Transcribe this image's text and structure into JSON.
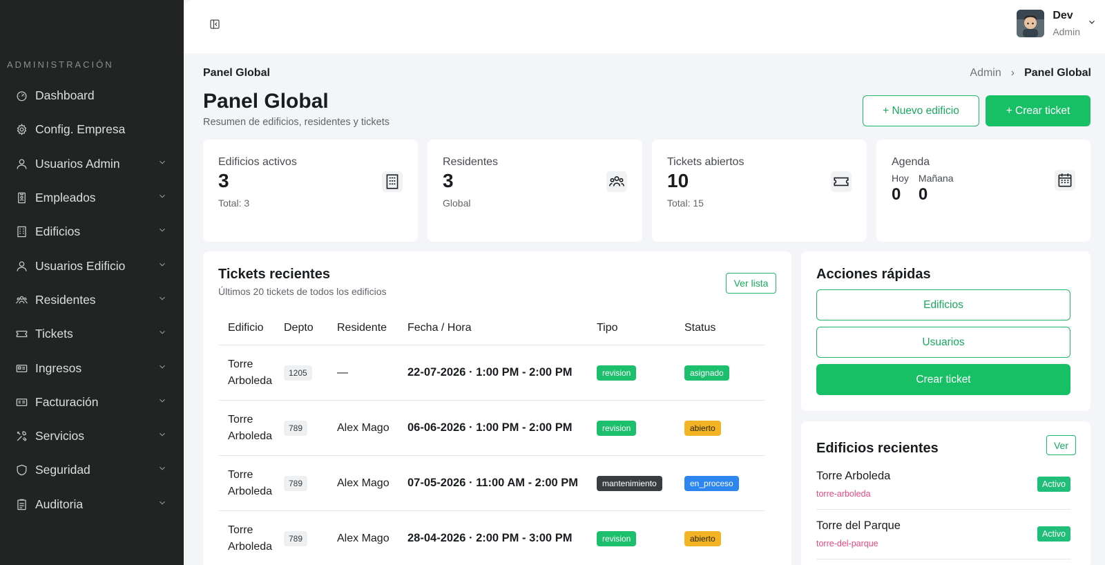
{
  "sidebar": {
    "section": "ADMINISTRACIÓN",
    "items": [
      {
        "label": "Dashboard",
        "icon": "dashboard-icon",
        "chevron": false
      },
      {
        "label": "Config. Empresa",
        "icon": "gear-icon",
        "chevron": false
      },
      {
        "label": "Usuarios Admin",
        "icon": "user-icon",
        "chevron": true
      },
      {
        "label": "Empleados",
        "icon": "badge-icon",
        "chevron": true
      },
      {
        "label": "Edificios",
        "icon": "building-icon",
        "chevron": true
      },
      {
        "label": "Usuarios Edificio",
        "icon": "user-icon",
        "chevron": true
      },
      {
        "label": "Residentes",
        "icon": "group-icon",
        "chevron": true
      },
      {
        "label": "Tickets",
        "icon": "ticket-icon",
        "chevron": true
      },
      {
        "label": "Ingresos",
        "icon": "id-card-icon",
        "chevron": true
      },
      {
        "label": "Facturación",
        "icon": "invoice-icon",
        "chevron": true
      },
      {
        "label": "Servicios",
        "icon": "tools-icon",
        "chevron": true
      },
      {
        "label": "Seguridad",
        "icon": "shield-icon",
        "chevron": true
      },
      {
        "label": "Auditoria",
        "icon": "clipboard-icon",
        "chevron": true
      }
    ]
  },
  "user": {
    "name": "Dev",
    "role": "Admin"
  },
  "breadcrumb": {
    "left": "Panel Global",
    "root": "Admin",
    "separator": "›",
    "current": "Panel Global"
  },
  "page": {
    "title": "Panel Global",
    "subtitle": "Resumen de edificios, residentes y tickets"
  },
  "actions": {
    "new_building": "+ Nuevo edificio",
    "create_ticket": "+ Crear ticket"
  },
  "stats": {
    "buildings": {
      "label": "Edificios activos",
      "value": "3",
      "sub": "Total: 3"
    },
    "residents": {
      "label": "Residentes",
      "value": "3",
      "sub": "Global"
    },
    "tickets": {
      "label": "Tickets abiertos",
      "value": "10",
      "sub": "Total: 15"
    },
    "agenda": {
      "label": "Agenda",
      "today_label": "Hoy",
      "today_value": "0",
      "tomorrow_label": "Mañana",
      "tomorrow_value": "0"
    }
  },
  "tickets": {
    "title": "Tickets recientes",
    "subtitle": "Últimos 20 tickets de todos los edificios",
    "view_list": "Ver lista",
    "columns": [
      "Edificio",
      "Depto",
      "Residente",
      "Fecha / Hora",
      "Tipo",
      "Status"
    ],
    "rows": [
      {
        "building": "Torre Arboleda",
        "depto": "1205",
        "resident": "—",
        "datetime": "22-07-2026 · 1:00 PM - 2:00 PM",
        "type": "revision",
        "status": "asignado"
      },
      {
        "building": "Torre Arboleda",
        "depto": "789",
        "resident": "Alex Mago",
        "datetime": "06-06-2026 · 1:00 PM - 2:00 PM",
        "type": "revision",
        "status": "abierto"
      },
      {
        "building": "Torre Arboleda",
        "depto": "789",
        "resident": "Alex Mago",
        "datetime": "07-05-2026 · 11:00 AM - 2:00 PM",
        "type": "mantenimiento",
        "status": "en_proceso"
      },
      {
        "building": "Torre Arboleda",
        "depto": "789",
        "resident": "Alex Mago",
        "datetime": "28-04-2026 · 2:00 PM - 3:00 PM",
        "type": "revision",
        "status": "abierto"
      }
    ]
  },
  "quick_actions": {
    "title": "Acciones rápidas",
    "buildings": "Edificios",
    "users": "Usuarios",
    "create_ticket": "Crear ticket"
  },
  "recent_buildings": {
    "title": "Edificios recientes",
    "view": "Ver",
    "items": [
      {
        "name": "Torre Arboleda",
        "slug": "torre-arboleda",
        "status": "Activo"
      },
      {
        "name": "Torre del Parque",
        "slug": "torre-del-parque",
        "status": "Activo"
      }
    ]
  },
  "colors": {
    "accent": "#18c065",
    "revision": "#1cbf6b",
    "mantenimiento": "#3a3d40",
    "asignado": "#1cbf6b",
    "abierto": "#f2b324",
    "en_proceso": "#2d86f0",
    "slug": "#e8477d"
  }
}
